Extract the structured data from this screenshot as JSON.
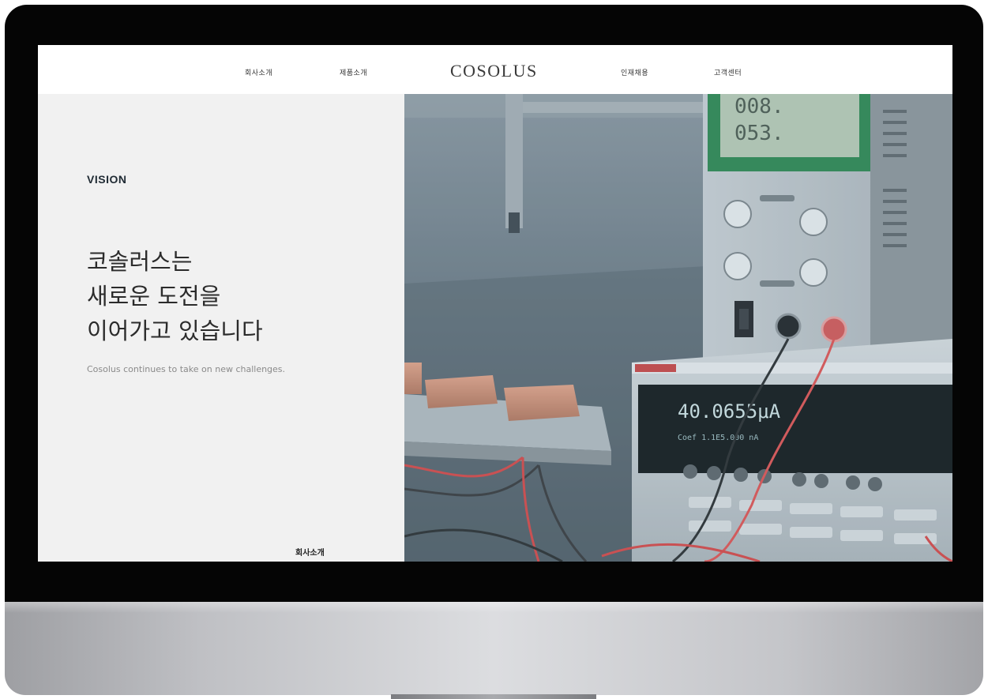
{
  "nav": {
    "items": [
      "회사소개",
      "제품소개",
      "인재채용",
      "고객센터"
    ],
    "logo": "COSOLUS"
  },
  "hero": {
    "section_label": "VISION",
    "headline_lines": [
      "코솔러스는",
      "새로운 도전을",
      "이어가고 있습니다"
    ],
    "subtitle": "Cosolus continues to take on new challenges.",
    "link_label": "회사소개"
  },
  "photo": {
    "meter_reading": "40.0655μA",
    "meter_sub": "Coef 1.1E5.000 nA",
    "psu_display_top": "008.",
    "psu_display_bottom": "053."
  },
  "colors": {
    "bezel": "#050505",
    "screen_bg": "#f1f1f1",
    "photo_tint": "#6d8592",
    "accent_red": "#e05050"
  }
}
